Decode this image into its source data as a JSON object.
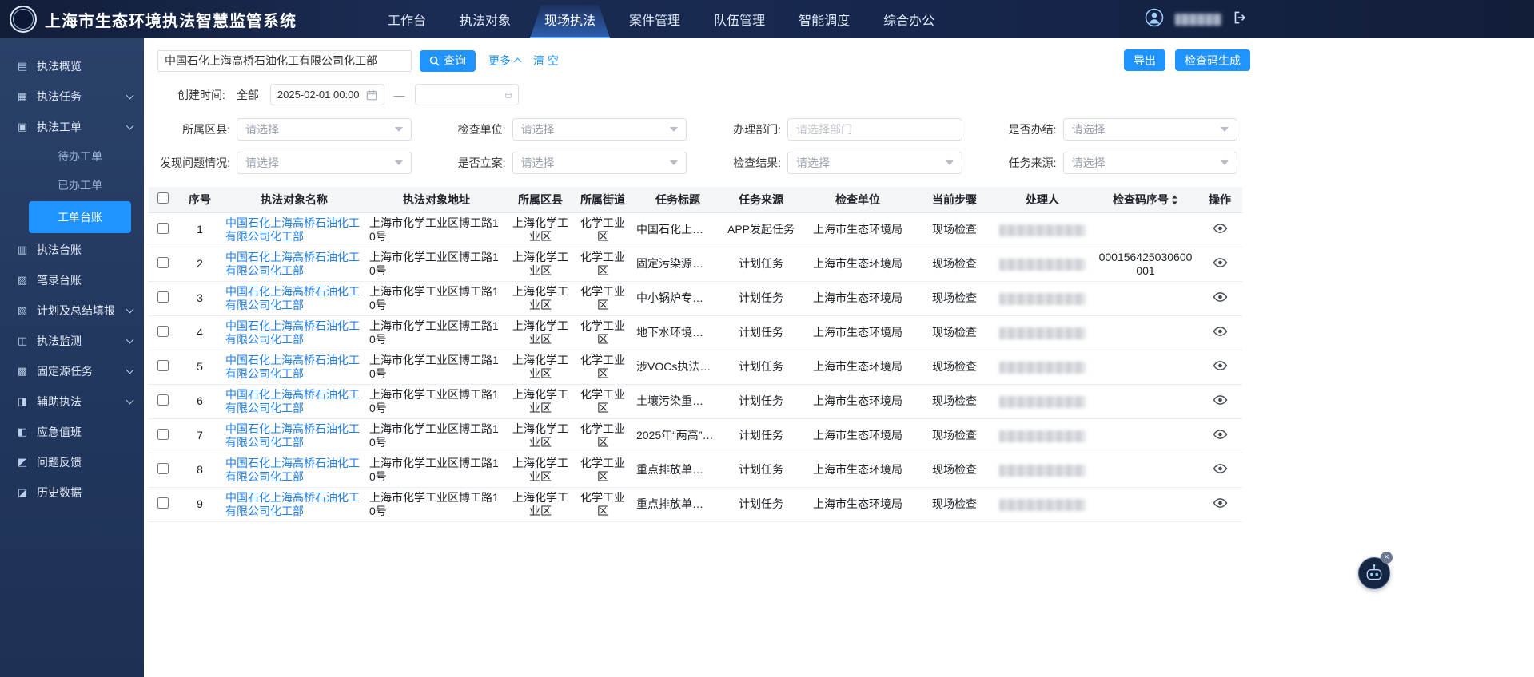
{
  "app": {
    "title": "上海市生态环境执法智慧监管系统"
  },
  "topnav": {
    "items": [
      {
        "label": "工作台",
        "active": false
      },
      {
        "label": "执法对象",
        "active": false
      },
      {
        "label": "现场执法",
        "active": true
      },
      {
        "label": "案件管理",
        "active": false
      },
      {
        "label": "队伍管理",
        "active": false
      },
      {
        "label": "智能调度",
        "active": false
      },
      {
        "label": "综合办公",
        "active": false
      }
    ]
  },
  "sidebar": {
    "items": [
      {
        "label": "执法概览",
        "icon": "overview-icon",
        "group": false
      },
      {
        "label": "执法任务",
        "icon": "task-list-icon",
        "group": true
      },
      {
        "label": "执法工单",
        "icon": "workorder-icon",
        "group": true,
        "children": [
          {
            "label": "待办工单",
            "active": false
          },
          {
            "label": "已办工单",
            "active": false
          },
          {
            "label": "工单台账",
            "active": true
          }
        ]
      },
      {
        "label": "执法台账",
        "icon": "ledger-icon",
        "group": false
      },
      {
        "label": "笔录台账",
        "icon": "notes-icon",
        "group": false
      },
      {
        "label": "计划及总结填报",
        "icon": "plan-icon",
        "group": true
      },
      {
        "label": "执法监测",
        "icon": "monitor-icon",
        "group": true
      },
      {
        "label": "固定源任务",
        "icon": "fixed-source-icon",
        "group": true
      },
      {
        "label": "辅助执法",
        "icon": "assist-icon",
        "group": true
      },
      {
        "label": "应急值班",
        "icon": "duty-icon",
        "group": false
      },
      {
        "label": "问题反馈",
        "icon": "feedback-icon",
        "group": false
      },
      {
        "label": "历史数据",
        "icon": "history-icon",
        "group": false
      }
    ]
  },
  "toolbar": {
    "search_value": "中国石化上海高桥石油化工有限公司化工部",
    "query_label": "查询",
    "more_label": "更多",
    "clear_label": "清 空",
    "export_label": "导出",
    "code_gen_label": "检查码生成"
  },
  "filters": {
    "create_time": {
      "label": "创建时间:",
      "all_label": "全部",
      "start_value": "2025-02-01 00:00",
      "end_value": "",
      "separator": "—"
    },
    "district": {
      "label": "所属区县:",
      "placeholder": "请选择"
    },
    "check_unit": {
      "label": "检查单位:",
      "placeholder": "请选择"
    },
    "department": {
      "label": "办理部门:",
      "placeholder": "请选择部门"
    },
    "is_done": {
      "label": "是否办结:",
      "placeholder": "请选择"
    },
    "problem": {
      "label": "发现问题情况:",
      "placeholder": "请选择"
    },
    "is_filed": {
      "label": "是否立案:",
      "placeholder": "请选择"
    },
    "check_result": {
      "label": "检查结果:",
      "placeholder": "请选择"
    },
    "task_source": {
      "label": "任务来源:",
      "placeholder": "请选择"
    }
  },
  "table": {
    "headers": [
      "序号",
      "执法对象名称",
      "执法对象地址",
      "所属区县",
      "所属街道",
      "任务标题",
      "任务来源",
      "检查单位",
      "当前步骤",
      "处理人",
      "检查码序号",
      "操作"
    ],
    "rows": [
      {
        "index": 1,
        "name": "中国石化上海高桥石油化工有限公司化工部",
        "address": "上海市化学工业区博工路10号",
        "district": "上海化学工业区",
        "street": "化学工业区",
        "task_title": "中国石化上…",
        "source": "APP发起任务",
        "unit": "上海市生态环境局",
        "step": "现场检查",
        "check_code": ""
      },
      {
        "index": 2,
        "name": "中国石化上海高桥石油化工有限公司化工部",
        "address": "上海市化学工业区博工路10号",
        "district": "上海化学工业区",
        "street": "化学工业区",
        "task_title": "固定污染源…",
        "source": "计划任务",
        "unit": "上海市生态环境局",
        "step": "现场检查",
        "check_code": "000156425030600001"
      },
      {
        "index": 3,
        "name": "中国石化上海高桥石油化工有限公司化工部",
        "address": "上海市化学工业区博工路10号",
        "district": "上海化学工业区",
        "street": "化学工业区",
        "task_title": "中小锅炉专…",
        "source": "计划任务",
        "unit": "上海市生态环境局",
        "step": "现场检查",
        "check_code": ""
      },
      {
        "index": 4,
        "name": "中国石化上海高桥石油化工有限公司化工部",
        "address": "上海市化学工业区博工路10号",
        "district": "上海化学工业区",
        "street": "化学工业区",
        "task_title": "地下水环境…",
        "source": "计划任务",
        "unit": "上海市生态环境局",
        "step": "现场检查",
        "check_code": ""
      },
      {
        "index": 5,
        "name": "中国石化上海高桥石油化工有限公司化工部",
        "address": "上海市化学工业区博工路10号",
        "district": "上海化学工业区",
        "street": "化学工业区",
        "task_title": "涉VOCs执法…",
        "source": "计划任务",
        "unit": "上海市生态环境局",
        "step": "现场检查",
        "check_code": ""
      },
      {
        "index": 6,
        "name": "中国石化上海高桥石油化工有限公司化工部",
        "address": "上海市化学工业区博工路10号",
        "district": "上海化学工业区",
        "street": "化学工业区",
        "task_title": "土壤污染重…",
        "source": "计划任务",
        "unit": "上海市生态环境局",
        "step": "现场检查",
        "check_code": ""
      },
      {
        "index": 7,
        "name": "中国石化上海高桥石油化工有限公司化工部",
        "address": "上海市化学工业区博工路10号",
        "district": "上海化学工业区",
        "street": "化学工业区",
        "task_title": "2025年“两高”…",
        "source": "计划任务",
        "unit": "上海市生态环境局",
        "step": "现场检查",
        "check_code": ""
      },
      {
        "index": 8,
        "name": "中国石化上海高桥石油化工有限公司化工部",
        "address": "上海市化学工业区博工路10号",
        "district": "上海化学工业区",
        "street": "化学工业区",
        "task_title": "重点排放单…",
        "source": "计划任务",
        "unit": "上海市生态环境局",
        "step": "现场检查",
        "check_code": ""
      },
      {
        "index": 9,
        "name": "中国石化上海高桥石油化工有限公司化工部",
        "address": "上海市化学工业区博工路10号",
        "district": "上海化学工业区",
        "street": "化学工业区",
        "task_title": "重点排放单…",
        "source": "计划任务",
        "unit": "上海市生态环境局",
        "step": "现场检查",
        "check_code": ""
      }
    ]
  },
  "assistant": {
    "close_icon": "×"
  }
}
